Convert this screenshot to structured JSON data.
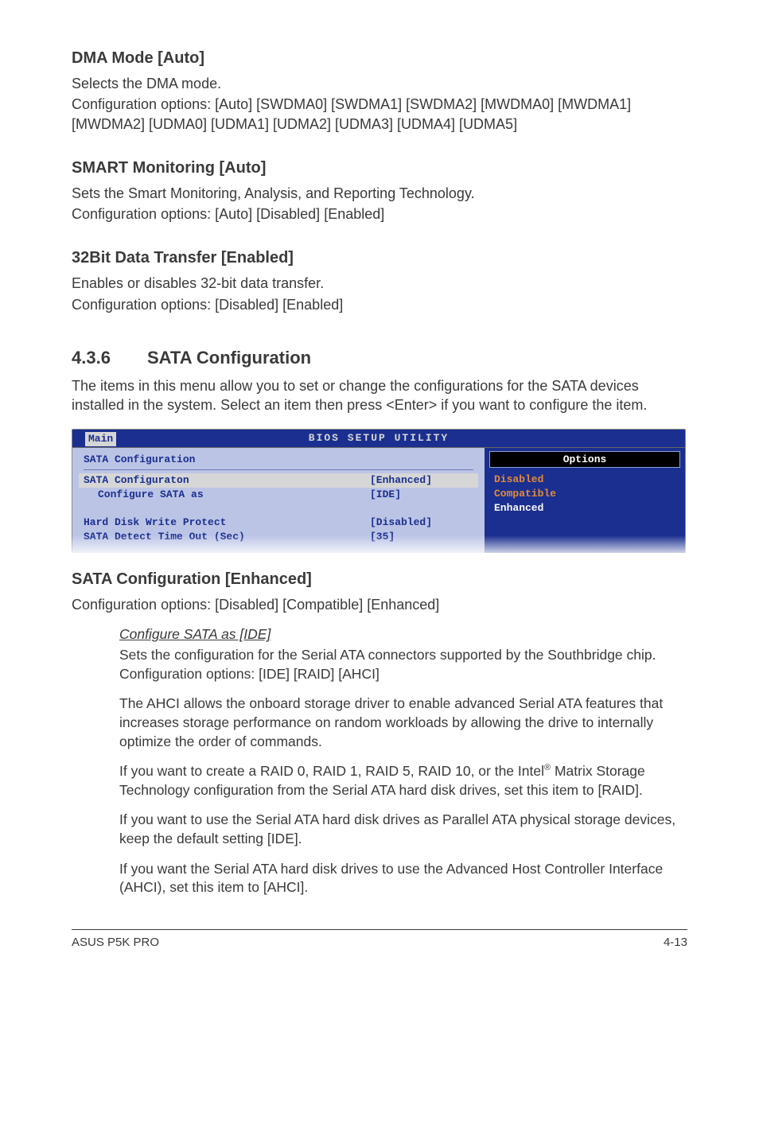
{
  "sections": {
    "dma": {
      "heading": "DMA Mode [Auto]",
      "line1": "Selects the DMA mode.",
      "line2": "Configuration options: [Auto] [SWDMA0] [SWDMA1] [SWDMA2] [MWDMA0] [MWDMA1] [MWDMA2] [UDMA0] [UDMA1] [UDMA2] [UDMA3] [UDMA4] [UDMA5]"
    },
    "smart": {
      "heading": "SMART Monitoring [Auto]",
      "line1": "Sets the Smart Monitoring, Analysis, and Reporting Technology.",
      "line2": "Configuration options: [Auto] [Disabled] [Enabled]"
    },
    "bit32": {
      "heading": "32Bit Data Transfer [Enabled]",
      "line1": "Enables or disables 32-bit data transfer.",
      "line2": "Configuration options: [Disabled] [Enabled]"
    },
    "sata": {
      "number": "4.3.6",
      "title": "SATA Configuration",
      "intro": "The items in this menu allow you to set or change the configurations for the SATA devices installed in the system. Select an item then press <Enter> if you want to configure the item."
    },
    "sataConfig": {
      "heading": "SATA Configuration [Enhanced]",
      "line1": "Configuration options: [Disabled] [Compatible] [Enhanced]"
    }
  },
  "bios": {
    "title": "BIOS SETUP UTILITY",
    "tab": "Main",
    "subtitle": "SATA Configuration",
    "rows": [
      {
        "label": "SATA Configuraton",
        "value": "[Enhanced]",
        "highlight": true
      },
      {
        "label": "Configure SATA as",
        "value": "[IDE]",
        "indent": true
      },
      {
        "label": "",
        "value": ""
      },
      {
        "label": "Hard Disk Write Protect",
        "value": "[Disabled]"
      },
      {
        "label": "SATA Detect Time Out (Sec)",
        "value": "[35]"
      }
    ],
    "optionsTitle": "Options",
    "options": [
      "Disabled",
      "Compatible",
      "Enhanced"
    ],
    "selectedOption": "Enhanced"
  },
  "sub": {
    "heading": "Configure SATA as [IDE]",
    "p1": "Sets the configuration for the Serial ATA connectors supported by the Southbridge chip. Configuration options: [IDE] [RAID] [AHCI]",
    "p2": "The AHCI allows the onboard storage driver to enable advanced Serial ATA features that increases storage performance on random workloads by allowing the drive to internally optimize the order of commands.",
    "p3a": "If you want to create a RAID 0, RAID 1, RAID 5, RAID 10, or the Intel",
    "p3b": " Matrix Storage Technology configuration from the Serial ATA hard disk drives, set this item to [RAID].",
    "p4": "If you want to use the Serial ATA hard disk drives as Parallel ATA physical storage devices, keep the default setting [IDE].",
    "p5": "If you want the Serial ATA hard disk drives to use the Advanced Host Controller Interface (AHCI), set this item to [AHCI]."
  },
  "footer": {
    "left": "ASUS P5K PRO",
    "right": "4-13"
  }
}
